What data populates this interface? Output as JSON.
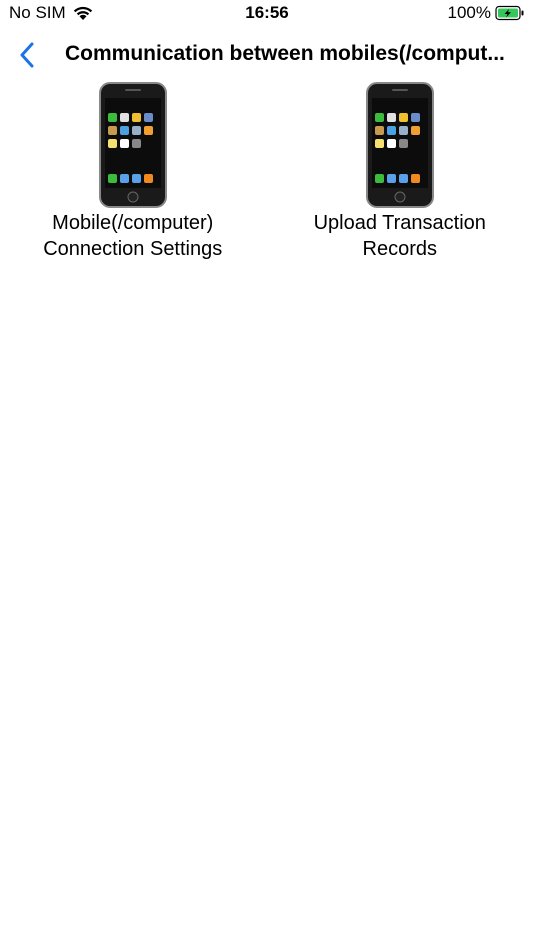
{
  "status_bar": {
    "carrier": "No SIM",
    "time": "16:56",
    "battery_percent": "100%",
    "battery_color": "#34c759"
  },
  "nav": {
    "back_icon": "chevron-left-icon",
    "title": "Communication between mobiles(/comput...",
    "accent": "#1a73e8"
  },
  "items": [
    {
      "label": "Mobile(/computer) Connection Settings",
      "icon": "mobile-phone-icon"
    },
    {
      "label": "Upload Transaction Records",
      "icon": "mobile-phone-icon"
    }
  ]
}
